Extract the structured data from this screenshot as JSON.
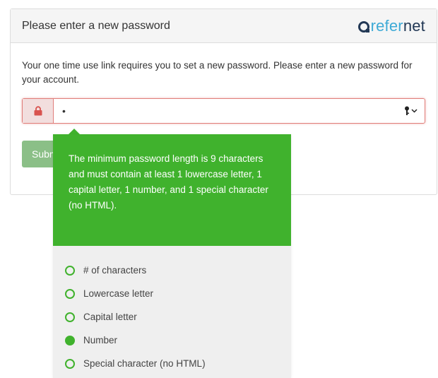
{
  "header": {
    "title": "Please enter a new password",
    "logo_part1": "refer",
    "logo_part2": "net"
  },
  "intro_text": "Your one time use link requires you to set a new password. Please enter a new password for your account.",
  "password_field": {
    "value": "•",
    "icon": "lock-icon",
    "toggle_icon": "key-icon"
  },
  "submit_button": {
    "label": "Submit"
  },
  "tooltip": {
    "message": "The minimum password length is 9 characters and must contain at least 1 lowercase letter, 1 capital letter, 1 number, and 1 special character (no HTML).",
    "requirements": [
      {
        "label": "# of characters",
        "met": false
      },
      {
        "label": "Lowercase letter",
        "met": false
      },
      {
        "label": "Capital letter",
        "met": false
      },
      {
        "label": "Number",
        "met": true
      },
      {
        "label": "Special character (no HTML)",
        "met": false
      }
    ]
  },
  "colors": {
    "success_green": "#40b22d",
    "error_border": "#e07e7a",
    "error_bg": "#f2dede",
    "lock_red": "#d9534f",
    "logo_blue": "#3eaad6",
    "logo_navy": "#223855",
    "submit_green": "#8bbf87"
  }
}
